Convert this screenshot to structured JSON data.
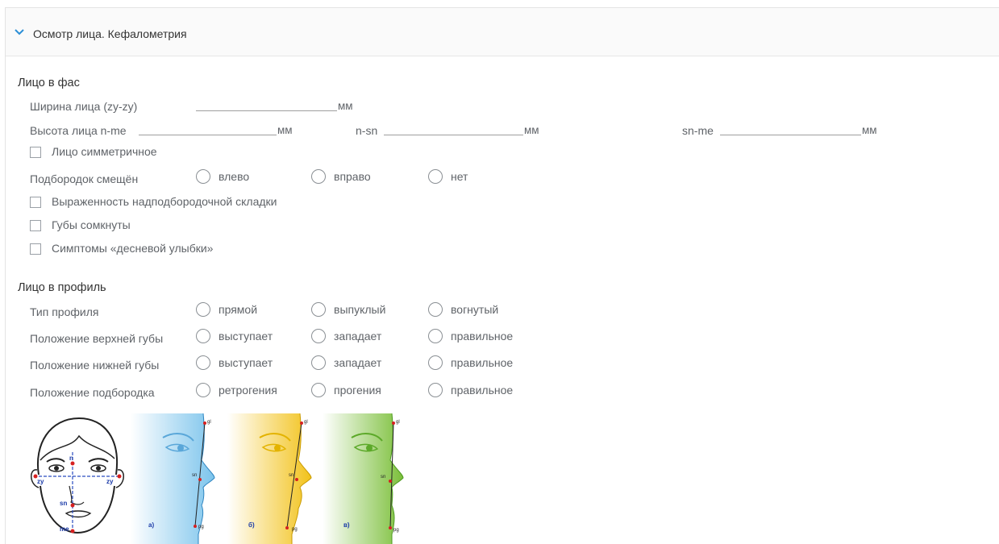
{
  "panel": {
    "title": "Осмотр лица. Кефалометрия"
  },
  "front": {
    "title": "Лицо в фас",
    "width_label": "Ширина лица (zy-zy)",
    "height_label": "Высота лица n-me",
    "nsn_label": "n-sn",
    "snme_label": "sn-me",
    "unit": "мм",
    "symmetric_label": "Лицо симметричное",
    "chin_shift_label": "Подбородок смещён",
    "chin_options": [
      "влево",
      "вправо",
      "нет"
    ],
    "fold_label": "Выраженность надподбородочной складки",
    "lips_closed_label": "Губы сомкнуты",
    "gum_smile_label": "Симптомы «десневой улыбки»"
  },
  "profile": {
    "title": "Лицо в профиль",
    "rows": [
      {
        "label": "Тип профиля",
        "options": [
          "прямой",
          "выпуклый",
          "вогнутый"
        ]
      },
      {
        "label": "Положение верхней губы",
        "options": [
          "выступает",
          "западает",
          "правильное"
        ]
      },
      {
        "label": "Положение нижней губы",
        "options": [
          "выступает",
          "западает",
          "правильное"
        ]
      },
      {
        "label": "Положение подбородка",
        "options": [
          "ретрогения",
          "прогения",
          "правильное"
        ]
      }
    ]
  },
  "illustration": {
    "front_points": {
      "n": "n",
      "zy_left": "zy",
      "zy_right": "zy",
      "sn": "sn",
      "me": "me"
    },
    "profiles": [
      {
        "caption": "а)",
        "gl": "gl",
        "sn": "sn",
        "pg": "pg",
        "color": "#7cc4ec"
      },
      {
        "caption": "б)",
        "gl": "gl",
        "sn": "sn",
        "pg": "pg",
        "color": "#f2c21a"
      },
      {
        "caption": "в)",
        "gl": "gl",
        "sn": "sn",
        "pg": "pg",
        "color": "#7bbf3a"
      }
    ]
  }
}
